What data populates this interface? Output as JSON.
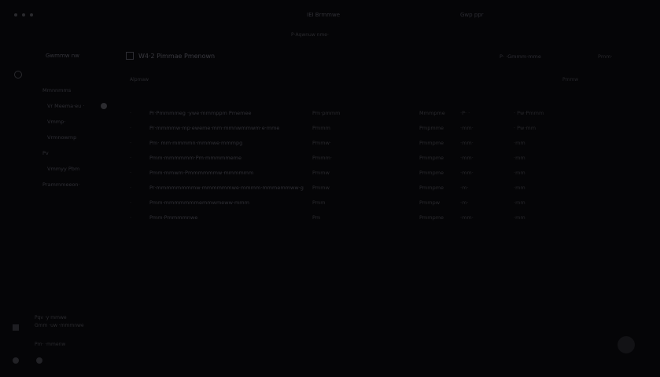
{
  "topbar": {
    "center": "IEI Brmmwe",
    "right": "Gwp  ppr",
    "sub": "P·Aqwnuw nme·"
  },
  "sidebar": {
    "workspace": "Gwmmw nw",
    "items": [
      {
        "label": "Mmnnmms",
        "indent": false
      },
      {
        "label": "Vr Meema·eu ·",
        "indent": true
      },
      {
        "label": "Vmmp·",
        "indent": true
      },
      {
        "label": "Vrmnowmp",
        "indent": true
      },
      {
        "label": "Pv",
        "indent": false
      },
      {
        "label": "Vmmyy Pbm",
        "indent": true
      },
      {
        "label": "Prammmeeon·",
        "indent": false
      }
    ],
    "user": [
      "Pqv ·y·mmwe",
      "Gmm ·uw ·mmmnwe"
    ],
    "footer": "Pm·   ·mmenw"
  },
  "main": {
    "title": "W4·2 Pimmae Pmenown",
    "action": "P·   ·Gmmm·mme",
    "action2": "Pmm·",
    "filter": "Alpmaw",
    "filter_right": "Pmmw",
    "rows": [
      {
        "n": "·",
        "title": "Pr·Pmmmmeg ·ywe·mmmppm Pmemee",
        "project": "Pm·pmmm",
        "status": "Mmmpme",
        "date": "·P·   ·",
        "assignee": "· Pw·Pmmm"
      },
      {
        "n": "·",
        "title": "Pr·mmmmw·mp·eweme·mm·mmnwmmwm·e·mme",
        "project": "Pmmm",
        "status": "Pmpmme",
        "date": "·mm·",
        "assignee": "· Pw·mm"
      },
      {
        "n": "·",
        "title": "Pm· mm·mmmmn·mmmwe·mmmpg",
        "project": "Pmmw·",
        "status": "Pmmpme",
        "date": "·mm·",
        "assignee": "·mm"
      },
      {
        "n": "·",
        "title": "Pmm·mmmmmm·Pm·mmmmmeme",
        "project": "Pmmm·",
        "status": "Pmmpme",
        "date": "·mm·",
        "assignee": "·mm"
      },
      {
        "n": "·",
        "title": "Pmm·mmwm·Pmmmmmmw·mmmmmm",
        "project": "Pmmw",
        "status": "Pmmpme",
        "date": "·mm·",
        "assignee": "·mm"
      },
      {
        "n": "·",
        "title": "Pr·mmmmmmmmw·mmmmmmwe·mmmm·mmmemmww·g",
        "project": "Pmmw",
        "status": "Pmmpme",
        "date": "·m·",
        "assignee": "·mm"
      },
      {
        "n": "·",
        "title": "Pmm·mmmmmmmemmwmeww·mmm",
        "project": "Pmm",
        "status": "Pmmpw",
        "date": "·m·",
        "assignee": "·mm"
      },
      {
        "n": "·",
        "title": "Pmm·Pmmmmnwe",
        "project": "Pm",
        "status": "Pmmpme",
        "date": "·mm·",
        "assignee": "·mm"
      }
    ]
  }
}
